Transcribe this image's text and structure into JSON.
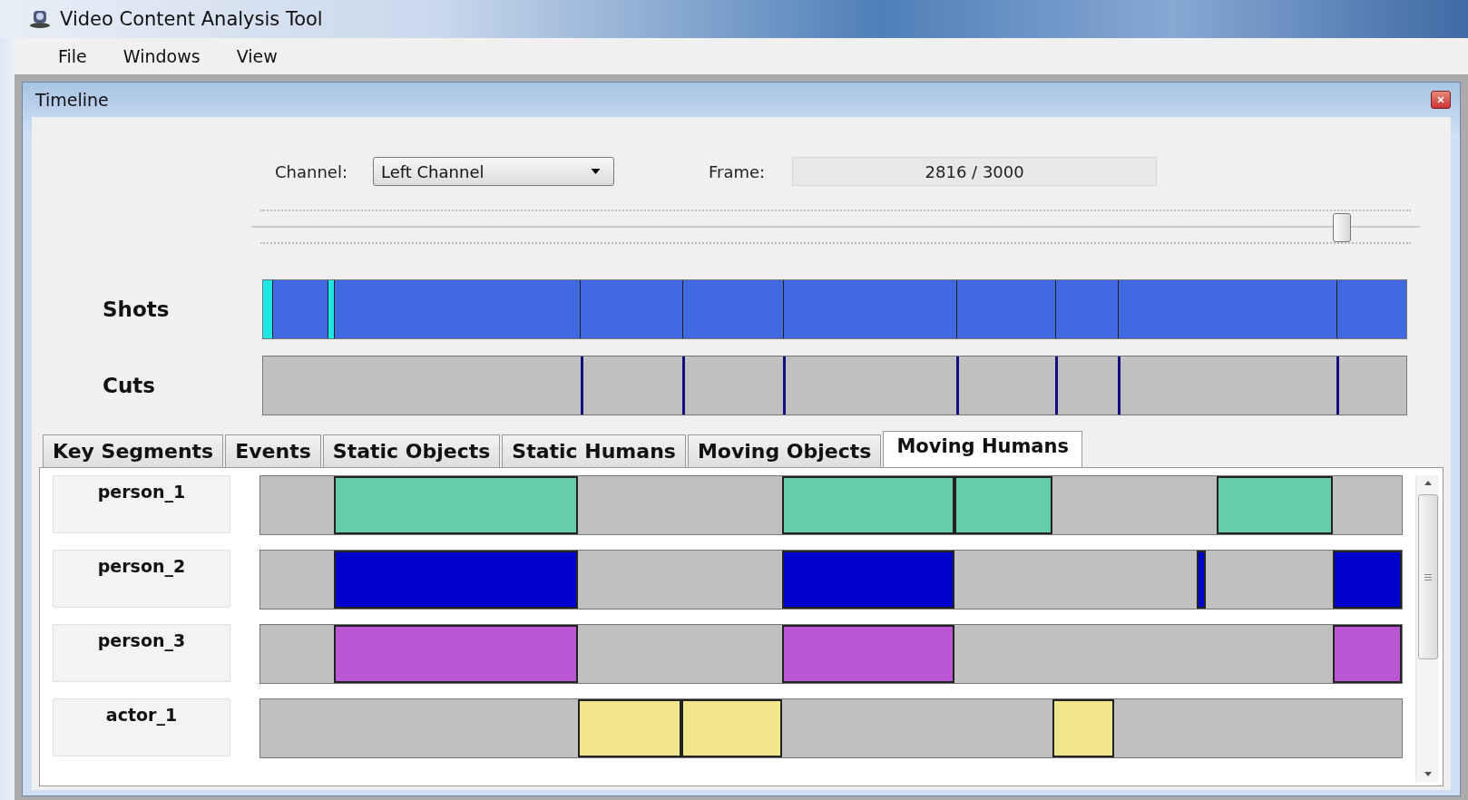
{
  "window": {
    "title": "Video Content Analysis Tool"
  },
  "menu": [
    "File",
    "Windows",
    "View"
  ],
  "panel": {
    "title": "Timeline"
  },
  "channel": {
    "label": "Channel:",
    "value": "Left Channel"
  },
  "frame": {
    "label": "Frame:",
    "value": "2816 / 3000"
  },
  "slider": {
    "level": 0.931
  },
  "shots": {
    "label": "Shots"
  },
  "cuts": {
    "label": "Cuts"
  },
  "tabs": [
    {
      "label": "Key Segments",
      "selected": false
    },
    {
      "label": "Events",
      "selected": false
    },
    {
      "label": "Static Objects",
      "selected": false
    },
    {
      "label": "Static Humans",
      "selected": false
    },
    {
      "label": "Moving Objects",
      "selected": false
    },
    {
      "label": "Moving Humans",
      "selected": true
    }
  ],
  "rows": [
    {
      "label": "person_1",
      "color": "#66cdaa"
    },
    {
      "label": "person_2",
      "color": "#0000cd"
    },
    {
      "label": "person_3",
      "color": "#ba55d3"
    },
    {
      "label": "actor_1",
      "color": "#f0e68c"
    }
  ]
}
